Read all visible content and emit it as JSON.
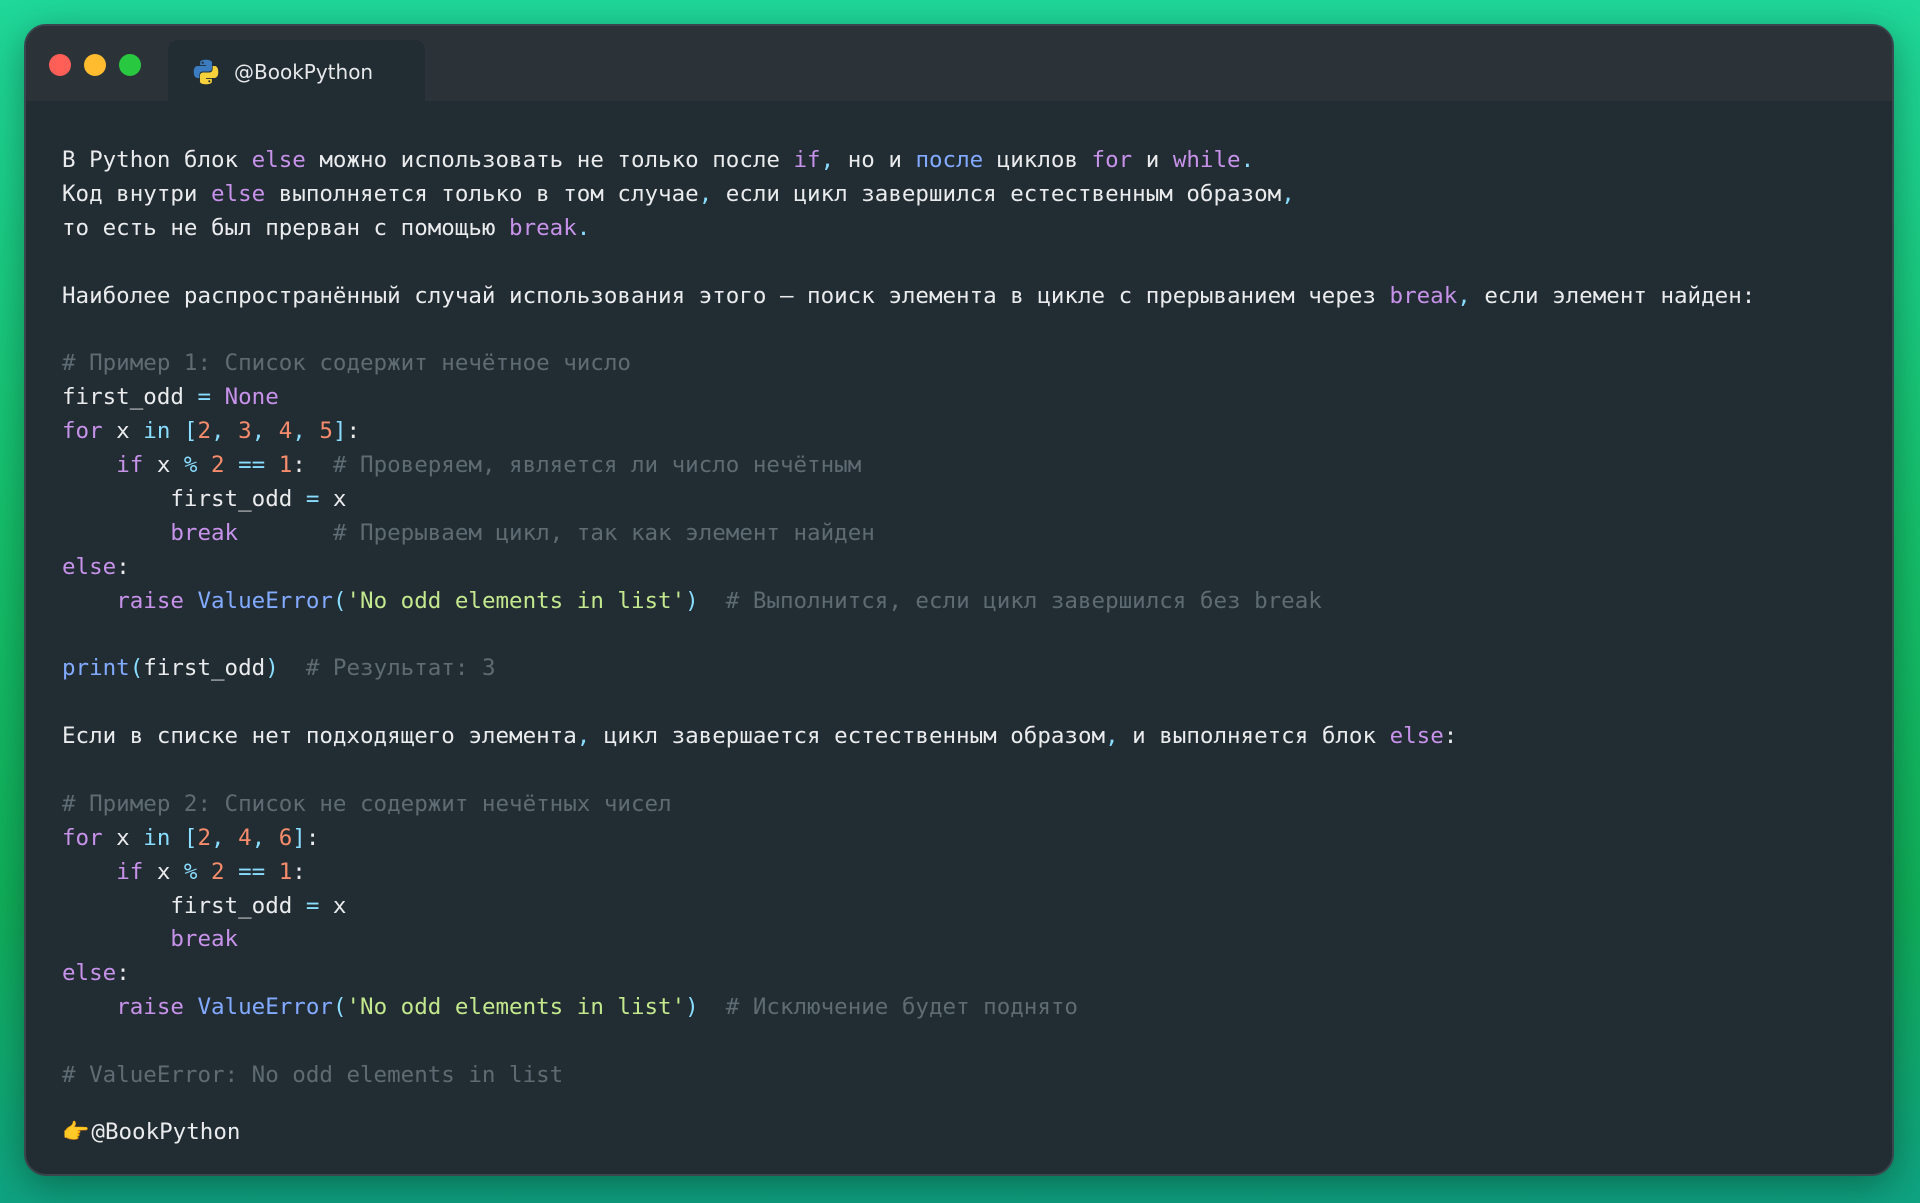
{
  "window": {
    "tab_title": "@BookPython",
    "footer_icon": "👉",
    "footer_handle": "@BookPython"
  },
  "lines": [
    [
      [
        "def",
        "В Python блок "
      ],
      [
        "kw",
        "else"
      ],
      [
        "def",
        " можно использовать не только после "
      ],
      [
        "kw",
        "if"
      ],
      [
        "op",
        ","
      ],
      [
        "def",
        " но и "
      ],
      [
        "bl",
        "после"
      ],
      [
        "def",
        " циклов "
      ],
      [
        "kw",
        "for"
      ],
      [
        "def",
        " и "
      ],
      [
        "kw",
        "while"
      ],
      [
        "op",
        "."
      ]
    ],
    [
      [
        "def",
        "Код внутри "
      ],
      [
        "kw",
        "else"
      ],
      [
        "def",
        " выполняется только в том случае"
      ],
      [
        "op",
        ","
      ],
      [
        "def",
        " если цикл завершился естественным образом"
      ],
      [
        "op",
        ","
      ]
    ],
    [
      [
        "def",
        "то есть не был прерван с помощью "
      ],
      [
        "kw",
        "break"
      ],
      [
        "op",
        "."
      ]
    ],
    [],
    [
      [
        "def",
        "Наиболее распространённый случай использования этого — поиск элемента в цикле с прерыванием через "
      ],
      [
        "kw",
        "break"
      ],
      [
        "op",
        ","
      ],
      [
        "def",
        " если элемент найден:"
      ]
    ],
    [],
    [
      [
        "cm",
        "# Пример 1: Список содержит нечётное число"
      ]
    ],
    [
      [
        "def",
        "first_odd "
      ],
      [
        "op",
        "="
      ],
      [
        "def",
        " "
      ],
      [
        "kw",
        "None"
      ]
    ],
    [
      [
        "kw",
        "for"
      ],
      [
        "def",
        " x "
      ],
      [
        "op",
        "in"
      ],
      [
        "def",
        " "
      ],
      [
        "op",
        "["
      ],
      [
        "num",
        "2"
      ],
      [
        "op",
        ","
      ],
      [
        "def",
        " "
      ],
      [
        "num",
        "3"
      ],
      [
        "op",
        ","
      ],
      [
        "def",
        " "
      ],
      [
        "num",
        "4"
      ],
      [
        "op",
        ","
      ],
      [
        "def",
        " "
      ],
      [
        "num",
        "5"
      ],
      [
        "op",
        "]"
      ],
      [
        "def",
        ":"
      ]
    ],
    [
      [
        "def",
        "    "
      ],
      [
        "kw",
        "if"
      ],
      [
        "def",
        " x "
      ],
      [
        "op",
        "%"
      ],
      [
        "def",
        " "
      ],
      [
        "num",
        "2"
      ],
      [
        "def",
        " "
      ],
      [
        "op",
        "=="
      ],
      [
        "def",
        " "
      ],
      [
        "num",
        "1"
      ],
      [
        "def",
        ":  "
      ],
      [
        "cm",
        "# Проверяем, является ли число нечётным"
      ]
    ],
    [
      [
        "def",
        "        first_odd "
      ],
      [
        "op",
        "="
      ],
      [
        "def",
        " x"
      ]
    ],
    [
      [
        "def",
        "        "
      ],
      [
        "kw",
        "break"
      ],
      [
        "def",
        "       "
      ],
      [
        "cm",
        "# Прерываем цикл, так как элемент найден"
      ]
    ],
    [
      [
        "kw",
        "else"
      ],
      [
        "def",
        ":"
      ]
    ],
    [
      [
        "def",
        "    "
      ],
      [
        "kw",
        "raise"
      ],
      [
        "def",
        " "
      ],
      [
        "cls",
        "ValueError"
      ],
      [
        "op",
        "("
      ],
      [
        "str",
        "'No odd elements in list'"
      ],
      [
        "op",
        ")"
      ],
      [
        "def",
        "  "
      ],
      [
        "cm",
        "# Выполнится, если цикл завершился без break"
      ]
    ],
    [],
    [
      [
        "bl",
        "print"
      ],
      [
        "op",
        "("
      ],
      [
        "def",
        "first_odd"
      ],
      [
        "op",
        ")"
      ],
      [
        "def",
        "  "
      ],
      [
        "cm",
        "# Результат: 3"
      ]
    ],
    [],
    [
      [
        "def",
        "Если в списке нет подходящего элемента"
      ],
      [
        "op",
        ","
      ],
      [
        "def",
        " цикл завершается естественным образом"
      ],
      [
        "op",
        ","
      ],
      [
        "def",
        " и выполняется блок "
      ],
      [
        "kw",
        "else"
      ],
      [
        "def",
        ":"
      ]
    ],
    [],
    [
      [
        "cm",
        "# Пример 2: Список не содержит нечётных чисел"
      ]
    ],
    [
      [
        "kw",
        "for"
      ],
      [
        "def",
        " x "
      ],
      [
        "op",
        "in"
      ],
      [
        "def",
        " "
      ],
      [
        "op",
        "["
      ],
      [
        "num",
        "2"
      ],
      [
        "op",
        ","
      ],
      [
        "def",
        " "
      ],
      [
        "num",
        "4"
      ],
      [
        "op",
        ","
      ],
      [
        "def",
        " "
      ],
      [
        "num",
        "6"
      ],
      [
        "op",
        "]"
      ],
      [
        "def",
        ":"
      ]
    ],
    [
      [
        "def",
        "    "
      ],
      [
        "kw",
        "if"
      ],
      [
        "def",
        " x "
      ],
      [
        "op",
        "%"
      ],
      [
        "def",
        " "
      ],
      [
        "num",
        "2"
      ],
      [
        "def",
        " "
      ],
      [
        "op",
        "=="
      ],
      [
        "def",
        " "
      ],
      [
        "num",
        "1"
      ],
      [
        "def",
        ":"
      ]
    ],
    [
      [
        "def",
        "        first_odd "
      ],
      [
        "op",
        "="
      ],
      [
        "def",
        " x"
      ]
    ],
    [
      [
        "def",
        "        "
      ],
      [
        "kw",
        "break"
      ]
    ],
    [
      [
        "kw",
        "else"
      ],
      [
        "def",
        ":"
      ]
    ],
    [
      [
        "def",
        "    "
      ],
      [
        "kw",
        "raise"
      ],
      [
        "def",
        " "
      ],
      [
        "cls",
        "ValueError"
      ],
      [
        "op",
        "("
      ],
      [
        "str",
        "'No odd elements in list'"
      ],
      [
        "op",
        ")"
      ],
      [
        "def",
        "  "
      ],
      [
        "cm",
        "# Исключение будет поднято"
      ]
    ],
    [],
    [
      [
        "cm",
        "# ValueError: No odd elements in list"
      ]
    ]
  ],
  "colors": {
    "background": "#222c33",
    "keyword": "#c792ea",
    "builtin": "#82aaff",
    "number": "#f78c6c",
    "string": "#c3e88d",
    "comment": "#5f6b73",
    "operator": "#89ddff",
    "text": "#e9ebed"
  }
}
